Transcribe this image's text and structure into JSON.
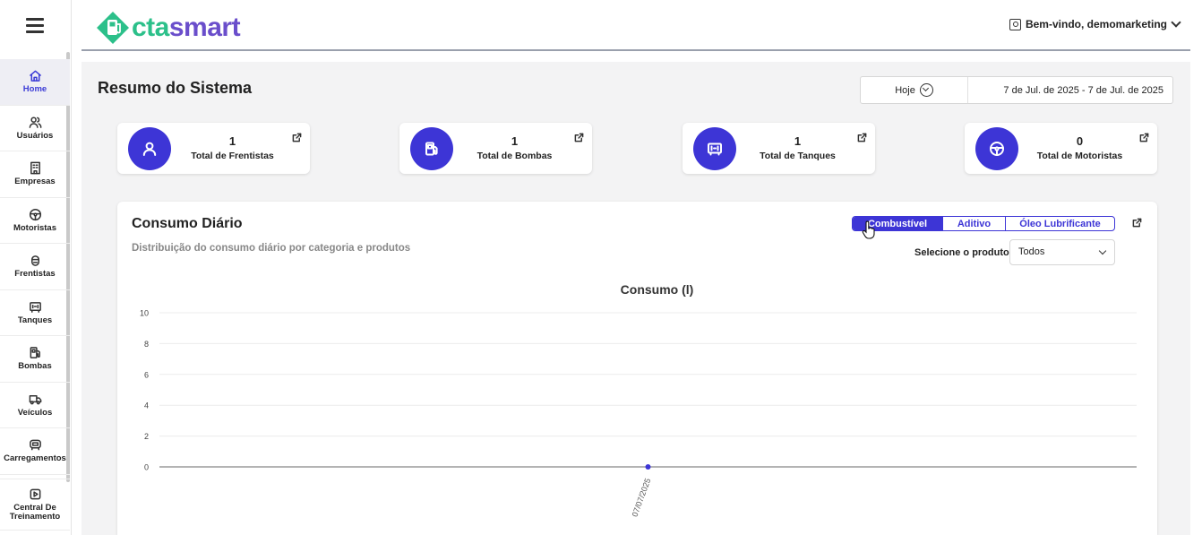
{
  "sidebar": {
    "items": [
      {
        "label": "Home",
        "icon": "home-icon",
        "active": true
      },
      {
        "label": "Usuários",
        "icon": "users-icon"
      },
      {
        "label": "Empresas",
        "icon": "building-icon"
      },
      {
        "label": "Motoristas",
        "icon": "steering-wheel-icon"
      },
      {
        "label": "Frentistas",
        "icon": "attendant-icon"
      },
      {
        "label": "Tanques",
        "icon": "tank-icon"
      },
      {
        "label": "Bombas",
        "icon": "fuel-pump-icon"
      },
      {
        "label": "Veículos",
        "icon": "truck-icon"
      },
      {
        "label": "Carregamentos",
        "icon": "loading-icon"
      }
    ],
    "training": {
      "label_line1": "Central De",
      "label_line2": "Treinamento",
      "icon": "play-icon"
    }
  },
  "header": {
    "logo": {
      "part1": "cta",
      "part2": "smart"
    },
    "user_greeting": "Bem-vindo, demomarketing"
  },
  "page": {
    "title": "Resumo do Sistema",
    "period": "Hoje",
    "date_range": "7 de Jul. de 2025 - 7 de Jul. de 2025"
  },
  "stats": [
    {
      "value": "1",
      "label": "Total de Frentistas",
      "icon": "user-icon"
    },
    {
      "value": "1",
      "label": "Total de Bombas",
      "icon": "fuel-pump-icon"
    },
    {
      "value": "1",
      "label": "Total de Tanques",
      "icon": "tank-icon"
    },
    {
      "value": "0",
      "label": "Total de Motoristas",
      "icon": "steering-wheel-icon"
    }
  ],
  "daily": {
    "title": "Consumo Diário",
    "subtitle": "Distribuição do consumo diário por categoria e produtos",
    "tabs": [
      {
        "label": "Combustível",
        "active": true
      },
      {
        "label": "Aditivo"
      },
      {
        "label": "Óleo Lubrificante"
      }
    ],
    "product_label": "Selecione o produto:",
    "product_value": "Todos"
  },
  "colors": {
    "accent": "#3d35d6",
    "logo_green": "#2cc08a",
    "logo_purple": "#6a4ecb"
  },
  "chart_data": {
    "type": "line",
    "title": "Consumo (l)",
    "x": [
      "07/07/2025"
    ],
    "series": [
      {
        "values": [
          0
        ]
      }
    ],
    "ylim": [
      0,
      10
    ],
    "yticks": [
      0,
      2,
      4,
      6,
      8,
      10
    ],
    "grid": true
  }
}
